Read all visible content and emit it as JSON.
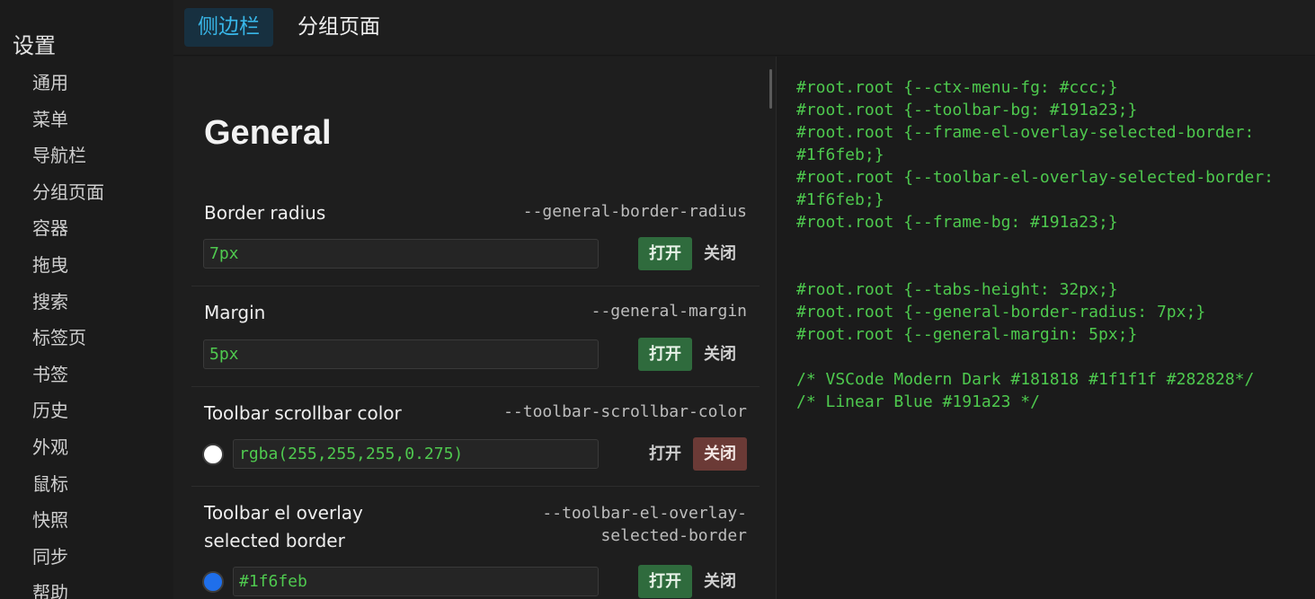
{
  "sidebar": {
    "title": "设置",
    "items": [
      {
        "label": "通用"
      },
      {
        "label": "菜单"
      },
      {
        "label": "导航栏"
      },
      {
        "label": "分组页面"
      },
      {
        "label": "容器"
      },
      {
        "label": "拖曳"
      },
      {
        "label": "搜索"
      },
      {
        "label": "标签页"
      },
      {
        "label": "书签"
      },
      {
        "label": "历史"
      },
      {
        "label": "外观"
      },
      {
        "label": "鼠标"
      },
      {
        "label": "快照"
      },
      {
        "label": "同步"
      },
      {
        "label": "帮助"
      }
    ]
  },
  "tabs": [
    {
      "label": "侧边栏",
      "active": true
    },
    {
      "label": "分组页面",
      "active": false
    }
  ],
  "panel": {
    "section_title": "General",
    "on_label": "打开",
    "off_label": "关闭",
    "settings": [
      {
        "label": "Border radius",
        "var": "--general-border-radius",
        "value": "7px",
        "state": "on"
      },
      {
        "label": "Margin",
        "var": "--general-margin",
        "value": "5px",
        "state": "on"
      },
      {
        "label": "Toolbar scrollbar color",
        "var": "--toolbar-scrollbar-color",
        "value": "rgba(255,255,255,0.275)",
        "swatch": "#ffffff",
        "state": "off"
      },
      {
        "label_line1": "Toolbar el overlay",
        "label_line2": "selected border",
        "var_line1": "--toolbar-el-overlay-",
        "var_line2": "selected-border",
        "value": "#1f6feb",
        "swatch": "#1f6feb",
        "state": "on"
      }
    ]
  },
  "code": {
    "lines": [
      "#root.root {--ctx-menu-fg: #ccc;}",
      "#root.root {--toolbar-bg: #191a23;}",
      "#root.root {--frame-el-overlay-selected-border:",
      "#1f6feb;}",
      "#root.root {--toolbar-el-overlay-selected-border:",
      "#1f6feb;}",
      "#root.root {--frame-bg: #191a23;}",
      "",
      "",
      "#root.root {--tabs-height: 32px;}",
      "#root.root {--general-border-radius: 7px;}",
      "#root.root {--general-margin: 5px;}",
      "",
      "/* VSCode Modern Dark #181818 #1f1f1f #282828*/",
      "/* Linear Blue #191a23 */"
    ]
  },
  "colors": {
    "accent_blue": "#38b6e8",
    "code_green": "#4ec94e",
    "on_button": "#2f6b3d",
    "off_button": "#6b3a36"
  }
}
